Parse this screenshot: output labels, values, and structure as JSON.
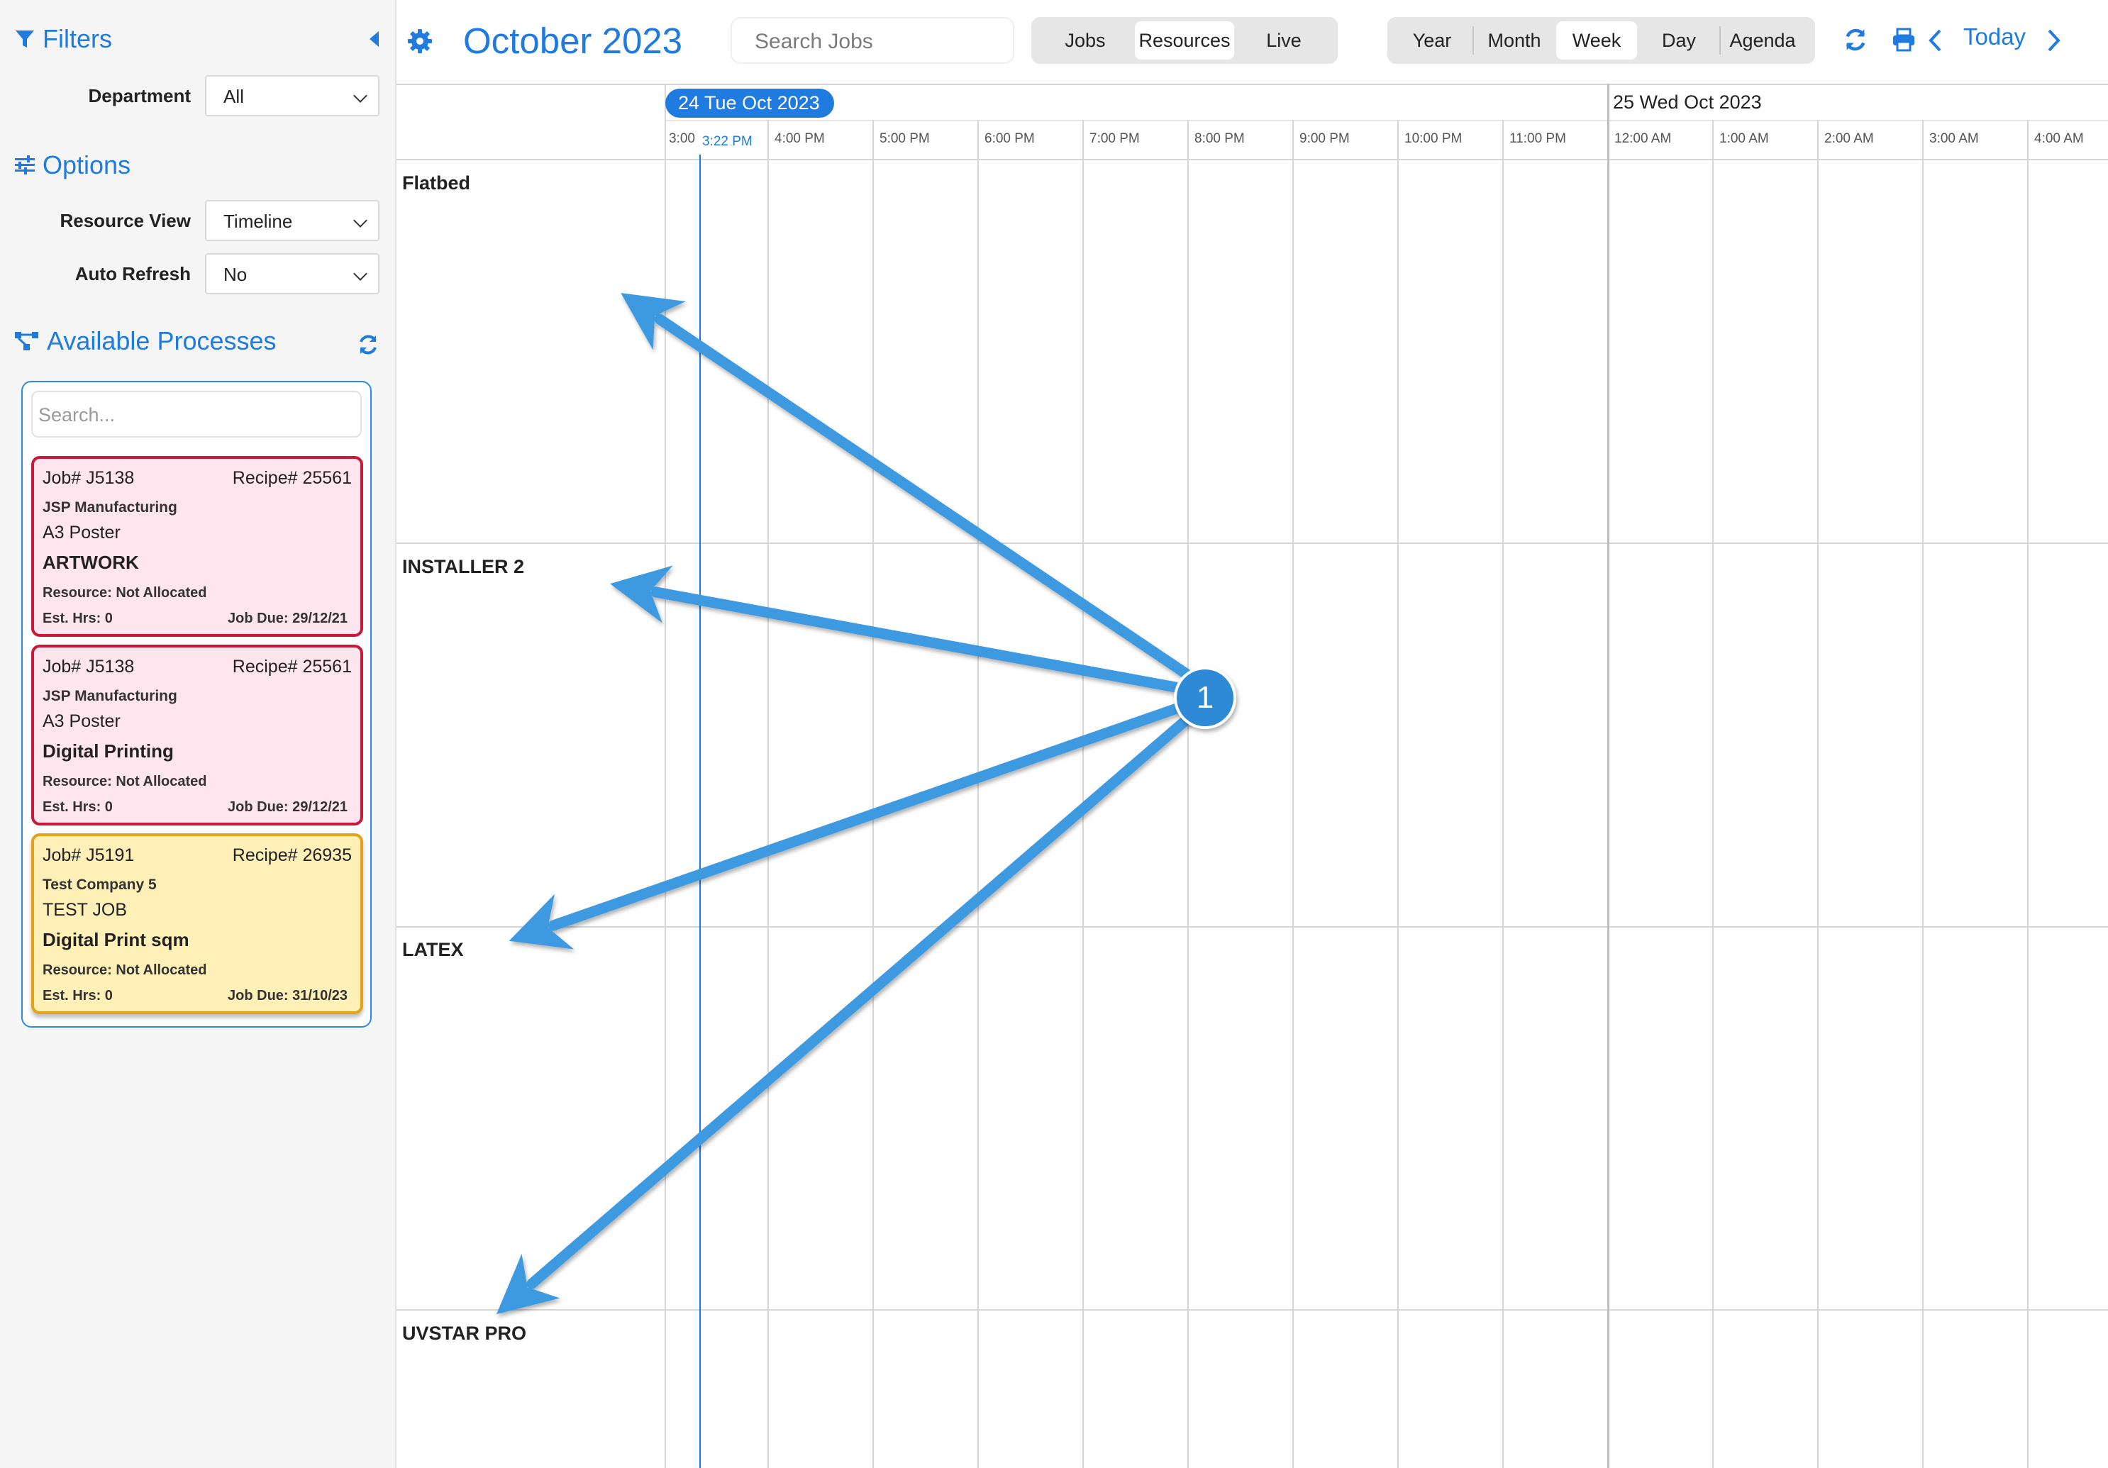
{
  "sidebar": {
    "filters_title": "Filters",
    "department_label": "Department",
    "department_value": "All",
    "options_title": "Options",
    "resource_view_label": "Resource View",
    "resource_view_value": "Timeline",
    "auto_refresh_label": "Auto Refresh",
    "auto_refresh_value": "No",
    "processes_title": "Available Processes",
    "search_placeholder": "Search...",
    "cards": [
      {
        "job": "Job# J5138",
        "recipe": "Recipe# 25561",
        "company": "JSP Manufacturing",
        "product": "A3 Poster",
        "process": "ARTWORK",
        "resource": "Resource: Not Allocated",
        "est": "Est. Hrs: 0",
        "due": "Job Due: 29/12/21",
        "status_color": "#c9183a"
      },
      {
        "job": "Job# J5138",
        "recipe": "Recipe# 25561",
        "company": "JSP Manufacturing",
        "product": "A3 Poster",
        "process": "Digital Printing",
        "resource": "Resource: Not Allocated",
        "est": "Est. Hrs: 0",
        "due": "Job Due: 29/12/21",
        "status_color": "#c9183a"
      },
      {
        "job": "Job# J5191",
        "recipe": "Recipe# 26935",
        "company": "Test Company 5",
        "product": "TEST JOB",
        "process": "Digital Print sqm",
        "resource": "Resource: Not Allocated",
        "est": "Est. Hrs: 0",
        "due": "Job Due: 31/10/23",
        "status_color": "#e2a21a"
      }
    ]
  },
  "toolbar": {
    "title": "October 2023",
    "search_placeholder": "Search Jobs",
    "modes": [
      "Jobs",
      "Resources",
      "Live"
    ],
    "active_mode": "Resources",
    "views": [
      "Year",
      "Month",
      "Week",
      "Day",
      "Agenda"
    ],
    "active_view": "Week",
    "today_label": "Today"
  },
  "timeline": {
    "day1_label": "24 Tue Oct 2023",
    "day2_label": "25 Wed Oct 2023",
    "hours": [
      "3:00",
      "4:00 PM",
      "5:00 PM",
      "6:00 PM",
      "7:00 PM",
      "8:00 PM",
      "9:00 PM",
      "10:00 PM",
      "11:00 PM",
      "12:00 AM",
      "1:00 AM",
      "2:00 AM",
      "3:00 AM",
      "4:00 AM"
    ],
    "now_label": "3:22 PM",
    "resources": [
      "Flatbed",
      "INSTALLER 2",
      "LATEX",
      "UVSTAR PRO"
    ]
  },
  "annotation": {
    "badge": "1",
    "color": "#3d9ae0"
  },
  "colors": {
    "accent": "#1f7be0",
    "overdue": "#c9183a",
    "due_soon": "#e2a21a"
  }
}
